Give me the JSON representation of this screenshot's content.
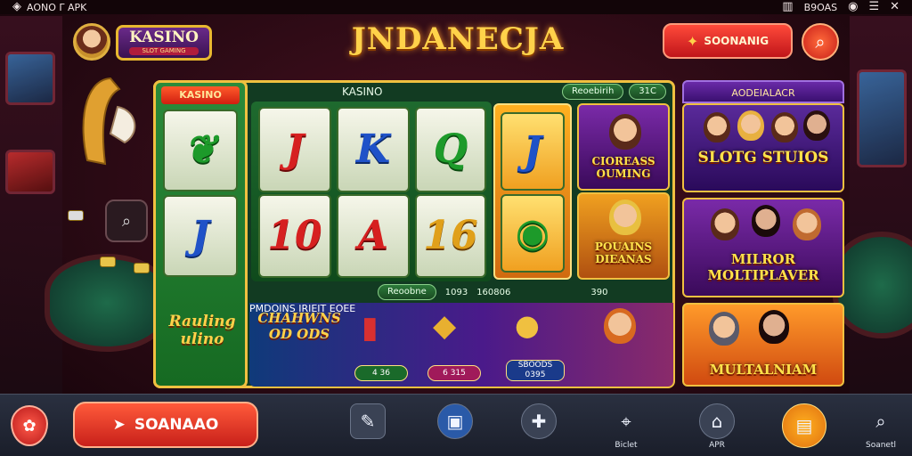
{
  "status_bar": {
    "left_text": "AONO Γ APK",
    "right_text": "B9OAS"
  },
  "header": {
    "brand_title": "KASINO",
    "brand_subtitle": "SLOT GAMING",
    "title": "JNDANECJA",
    "promo_button_label": "SOONANIG"
  },
  "left_panel": {
    "tab_label": "KASINO",
    "footer_text": "Rauling\nulino"
  },
  "reels": {
    "section_label": "KASINO",
    "top_pill": "Reoebirih",
    "top_pill_right": "31C",
    "symbols": [
      {
        "char": "J",
        "color": "red"
      },
      {
        "char": "K",
        "color": "blue"
      },
      {
        "char": "Q",
        "color": "green"
      },
      {
        "char": "10",
        "color": "red"
      },
      {
        "char": "A",
        "color": "red"
      },
      {
        "char": "16",
        "color": "gold"
      }
    ],
    "left_symbols": [
      {
        "char": "❦",
        "color": "green"
      },
      {
        "char": "J",
        "color": "blue"
      }
    ],
    "bonus_symbols": [
      {
        "char": "J",
        "color": "blue"
      },
      {
        "char": "◉",
        "color": "green"
      }
    ]
  },
  "cards": [
    {
      "caption": "CIOREASS OUMING"
    },
    {
      "caption": "POUAINS DIEANAS"
    }
  ],
  "midbar": {
    "label1": "Reoobne",
    "value1": "1093",
    "value2": "160806",
    "value3": "390"
  },
  "bottom_promo": {
    "headline": "CHAHWNS OD ODS",
    "tag1": "4 36",
    "tag2": "6 315",
    "tag3": "SBOODS 0395",
    "right_caption": "PMDOINS IRIEIT EOEE"
  },
  "right_column": {
    "header": "AODEIALACR",
    "card1": "SLOTG STUIOS",
    "card2": "MILROR MOLTIPLAVER",
    "card3": "MULTALNIAM"
  },
  "bottom_nav": {
    "play_label": "SOANAAO",
    "items": [
      {
        "label": "",
        "icon": "edit-icon"
      },
      {
        "label": "",
        "icon": "wallet-icon"
      },
      {
        "label": "",
        "icon": "chat-icon"
      },
      {
        "label": "Biclet",
        "icon": "location-icon"
      },
      {
        "label": "APR",
        "icon": "home-icon"
      },
      {
        "label": "",
        "icon": "card-icon"
      },
      {
        "label": "Soanetl",
        "icon": "search-icon"
      }
    ]
  },
  "colors": {
    "accent_red": "#c8201a",
    "gold": "#f0c040",
    "green": "#166a22",
    "purple": "#3a1070"
  }
}
